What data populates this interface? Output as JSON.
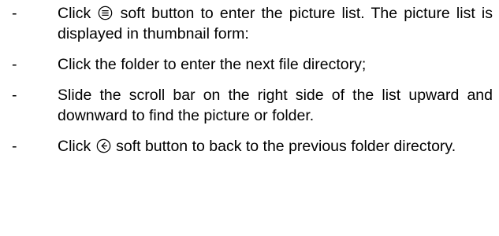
{
  "bullets": [
    {
      "marker": "-",
      "before": "Click",
      "icon": "list-circle-icon",
      "after": "soft button to enter the picture list. The picture list is displayed in thumbnail form:"
    },
    {
      "marker": "-",
      "text": "Click the folder to enter the next file directory;"
    },
    {
      "marker": "-",
      "text": "Slide the scroll bar on the right side of the list upward and downward to find the picture or folder."
    },
    {
      "marker": "-",
      "before": "Click",
      "icon": "back-arrow-circle-icon",
      "after": "soft button to back to the previous folder directory."
    }
  ]
}
